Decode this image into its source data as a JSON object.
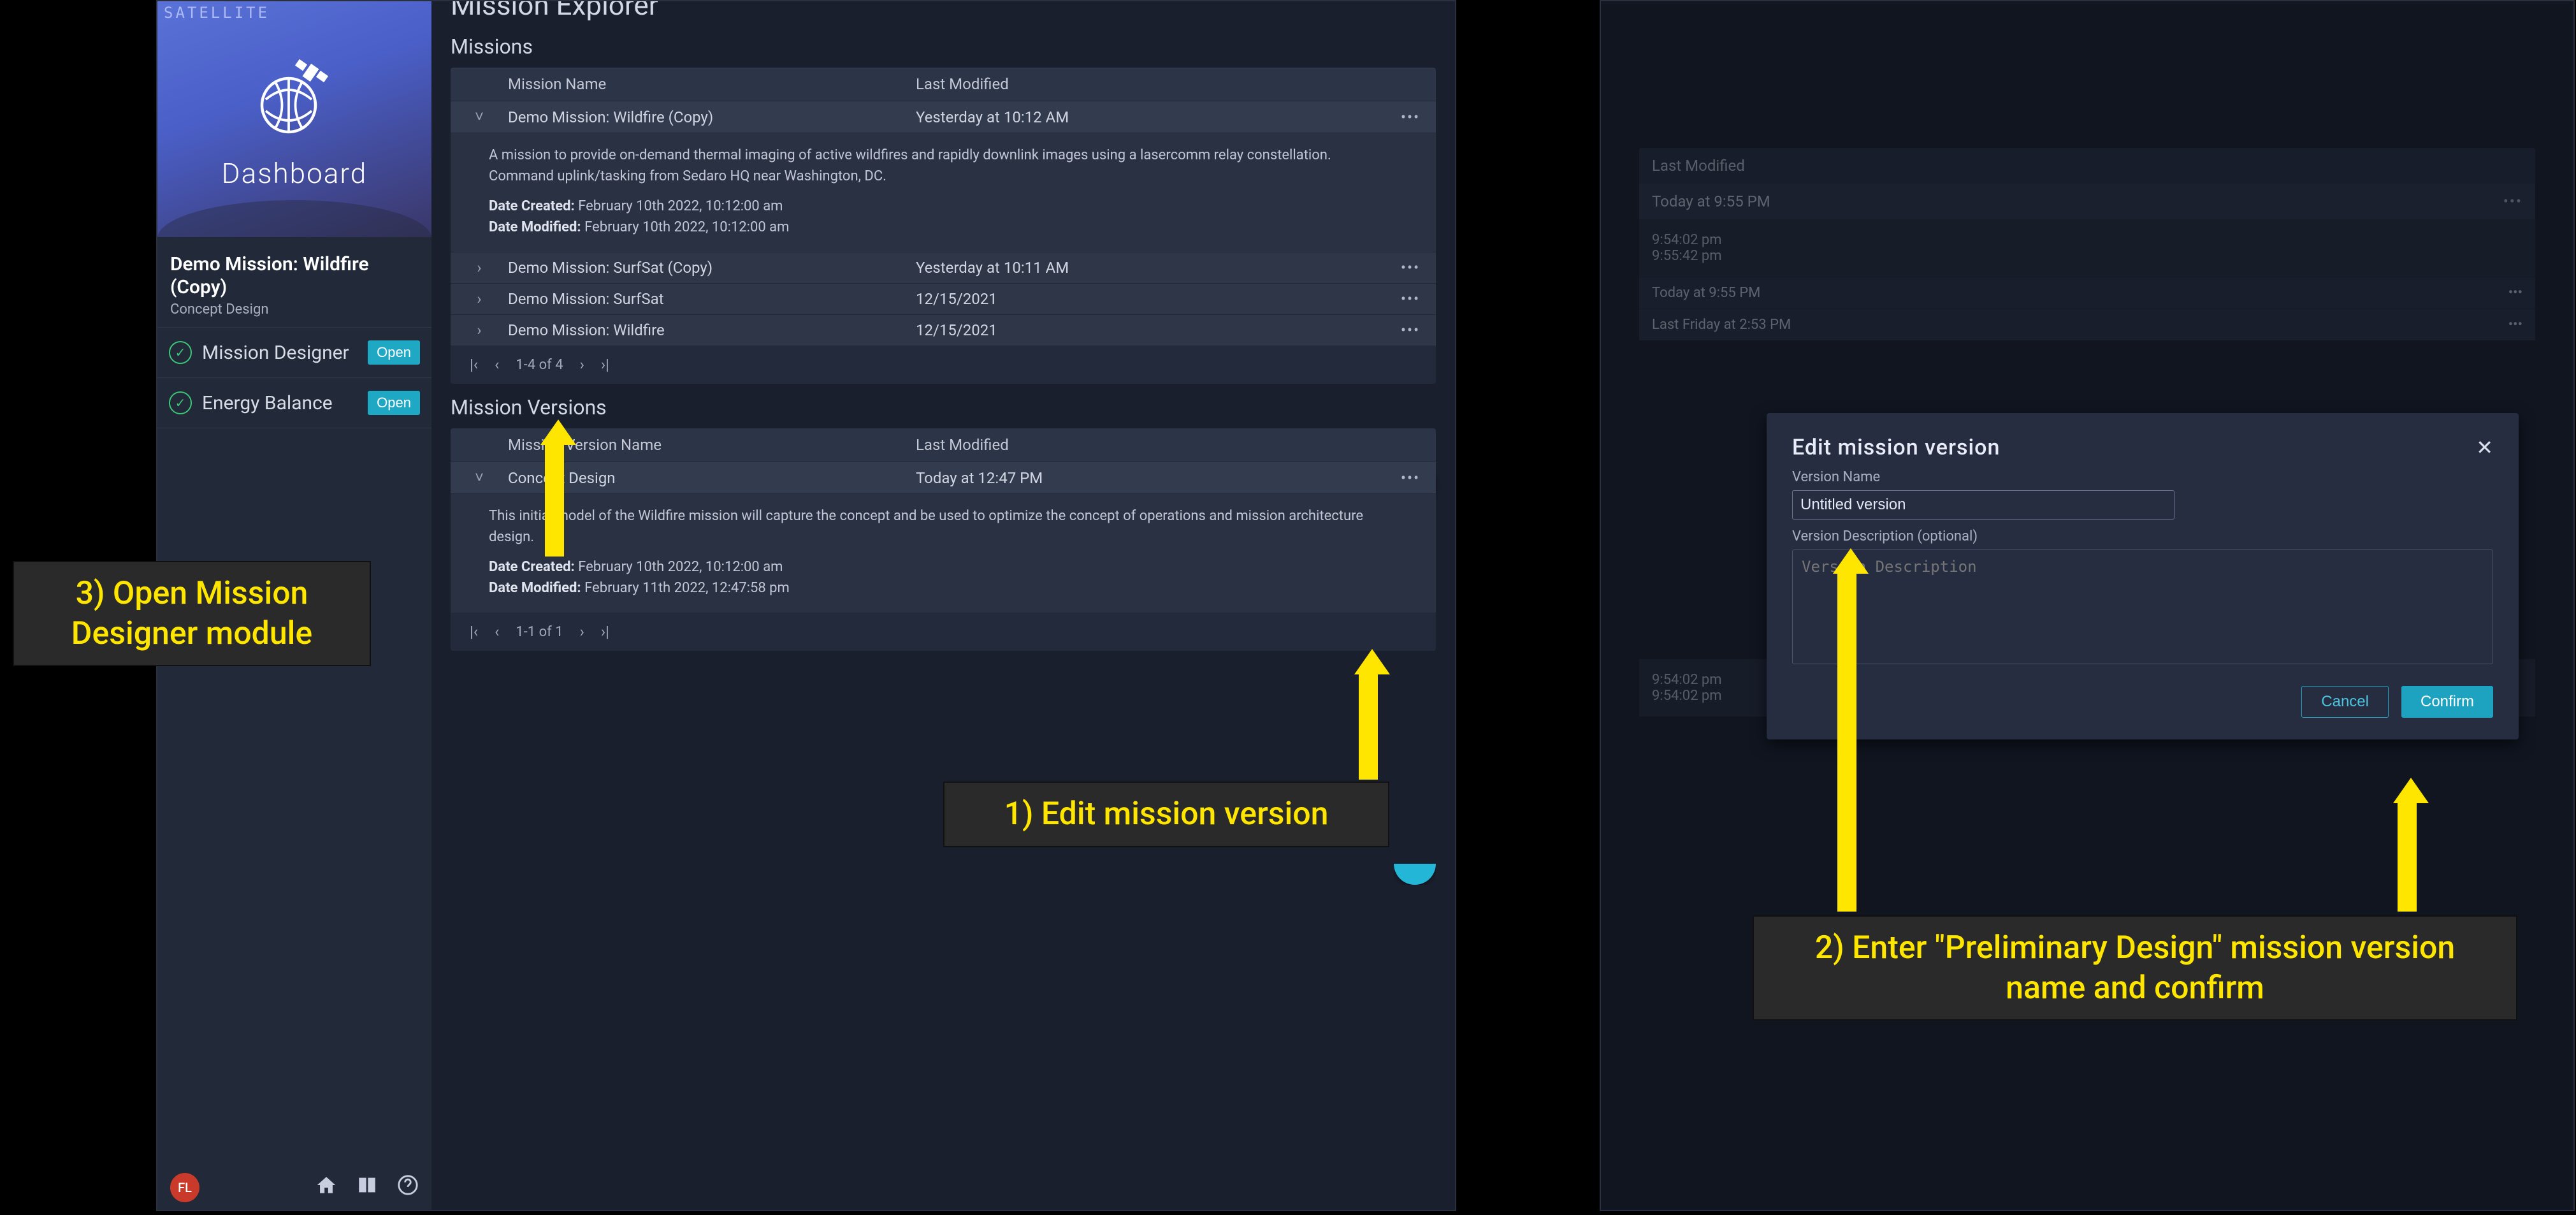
{
  "left": {
    "topbar_text": "Satellite",
    "dash_title": "Dashboard",
    "mission_title": "Demo Mission: Wildfire (Copy)",
    "mission_sub": "Concept Design",
    "modules": [
      {
        "name": "Mission Designer",
        "btn": "Open"
      },
      {
        "name": "Energy Balance",
        "btn": "Open"
      }
    ],
    "page_title": "Mission Explorer",
    "missions_title": "Missions",
    "missions_headers": {
      "name": "Mission Name",
      "mod": "Last Modified"
    },
    "missions": [
      {
        "name": "Demo Mission: Wildfire (Copy)",
        "mod": "Yesterday at 10:12 AM",
        "expanded": true,
        "desc": "A mission to provide on-demand thermal imaging of active wildfires and rapidly downlink images using a lasercomm relay constellation. Command uplink/tasking from Sedaro HQ near Washington, DC.",
        "created_label": "Date Created:",
        "created": "February 10th 2022, 10:12:00 am",
        "modified_label": "Date Modified:",
        "modified": "February 10th 2022, 10:12:00 am"
      },
      {
        "name": "Demo Mission: SurfSat (Copy)",
        "mod": "Yesterday at 10:11 AM"
      },
      {
        "name": "Demo Mission: SurfSat",
        "mod": "12/15/2021"
      },
      {
        "name": "Demo Mission: Wildfire",
        "mod": "12/15/2021"
      }
    ],
    "missions_pager": "1-4 of 4",
    "versions_title": "Mission Versions",
    "versions_headers": {
      "name": "Mission Version Name",
      "mod": "Last Modified"
    },
    "versions": [
      {
        "name": "Concept Design",
        "mod": "Today at 12:47 PM",
        "expanded": true,
        "desc": "This initial model of the Wildfire mission will capture the concept and be used to optimize the concept of operations and mission architecture design.",
        "created_label": "Date Created:",
        "created": "February 10th 2022, 10:12:00 am",
        "modified_label": "Date Modified:",
        "modified": "February 11th 2022, 12:47:58 pm"
      }
    ],
    "versions_pager": "1-1 of 1",
    "avatar": "FL"
  },
  "right": {
    "bg": {
      "header": "Last Modified",
      "row1": "Today at 9:55 PM",
      "detail_time1": "9:54:02 pm",
      "detail_time2": "9:55:42 pm",
      "row2": "Today at 9:55 PM",
      "row3": "Last Friday at 2:53 PM",
      "detail2_time1": "9:54:02 pm",
      "detail2_time2": "9:54:02 pm"
    },
    "dialog": {
      "title": "Edit mission version",
      "name_label": "Version Name",
      "name_value": "Untitled version",
      "desc_label": "Version Description (optional)",
      "desc_placeholder": "Version Description",
      "cancel": "Cancel",
      "confirm": "Confirm"
    }
  },
  "annotations": {
    "a1": "1) Edit mission version",
    "a2": "2) Enter \"Preliminary Design\" mission version name and confirm",
    "a3": "3) Open Mission Designer module"
  }
}
